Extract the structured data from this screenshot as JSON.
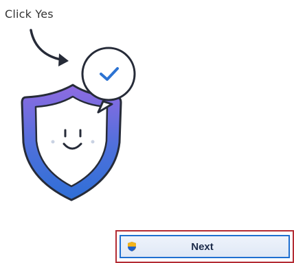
{
  "hint": {
    "text": "Click Yes"
  },
  "next_button": {
    "label": "Next",
    "icon": "uac-shield-icon"
  },
  "colors": {
    "highlight_border": "#b32b33",
    "button_border": "#1e6fd0",
    "shield_gradient_top": "#8f6be2",
    "shield_gradient_bottom": "#2f6fd6",
    "checkmark": "#2c73d2"
  }
}
